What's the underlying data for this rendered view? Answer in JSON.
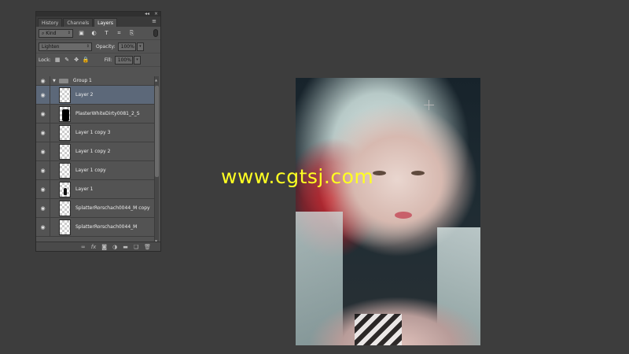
{
  "panel": {
    "collapse_icon": "◂◂",
    "close_icon": "×",
    "tabs": [
      {
        "label": "History"
      },
      {
        "label": "Channels"
      },
      {
        "label": "Layers"
      }
    ],
    "filter": {
      "kind_label": "Kind",
      "icons": [
        "image-filter-icon",
        "adjustment-filter-icon",
        "type-filter-icon",
        "shape-filter-icon",
        "smart-object-filter-icon"
      ]
    },
    "blend": {
      "mode": "Lighten",
      "opacity_label": "Opacity:",
      "opacity_value": "100%"
    },
    "lock": {
      "label": "Lock:",
      "fill_label": "Fill:",
      "fill_value": "100%"
    },
    "layers": [
      {
        "name": "Group 1",
        "type": "group"
      },
      {
        "name": "Layer 2",
        "selected": true,
        "thumb": "checker"
      },
      {
        "name": "PlasterWhiteDirty0081_2_S",
        "thumb": "dark"
      },
      {
        "name": "Layer 1 copy 3",
        "thumb": "checker"
      },
      {
        "name": "Layer 1 copy 2",
        "thumb": "checker"
      },
      {
        "name": "Layer 1 copy",
        "thumb": "checker"
      },
      {
        "name": "Layer 1",
        "thumb": "figure"
      },
      {
        "name": "SplatterRorschach0044_M copy",
        "thumb": "checker"
      },
      {
        "name": "SplatterRorschach0044_M",
        "thumb": "checker"
      }
    ],
    "footer_icons": [
      "link-layers-icon",
      "fx-icon",
      "mask-icon",
      "adjustment-layer-icon",
      "new-group-icon",
      "new-layer-icon",
      "trash-icon"
    ],
    "footer_fx": "fx"
  },
  "watermark": "www.cgtsj.com",
  "colors": {
    "selected_layer": "#5c6879",
    "panel_bg": "#535353",
    "workspace_bg": "#3d3d3d",
    "watermark": "#ffff22"
  }
}
